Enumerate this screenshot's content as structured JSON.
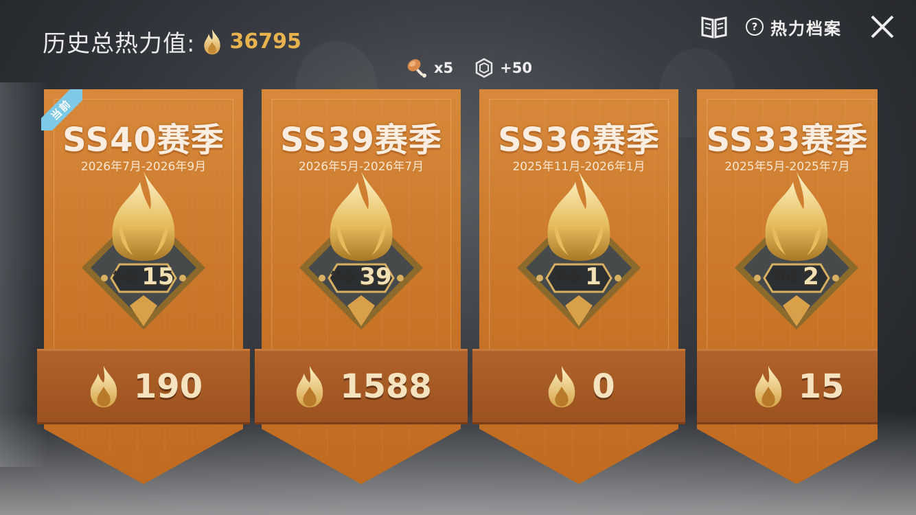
{
  "header": {
    "label": "历史总热力值:",
    "total_heat": "36795"
  },
  "top_right": {
    "help_label": "热力档案"
  },
  "rewards": [
    {
      "icon": "drumstick-icon",
      "value": "x5"
    },
    {
      "icon": "badge-icon",
      "value": "+50"
    }
  ],
  "current_badge": "当前",
  "cards": [
    {
      "title": "SS40赛季",
      "date": "2026年7月-2026年9月",
      "level_label": "等级",
      "level": "15",
      "score": "190"
    },
    {
      "title": "SS39赛季",
      "date": "2026年5月-2026年7月",
      "level_label": "等级",
      "level": "39",
      "score": "1588"
    },
    {
      "title": "SS36赛季",
      "date": "2025年11月-2026年1月",
      "level_label": "等级",
      "level": "1",
      "score": "0"
    },
    {
      "title": "SS33赛季",
      "date": "2025年5月-2025年7月",
      "level_label": "等级",
      "level": "2",
      "score": "15"
    }
  ],
  "colors": {
    "accent_gold": "#e8b24e",
    "card_orange": "#cc7a2c",
    "current_ribbon": "#7fc9e8"
  }
}
